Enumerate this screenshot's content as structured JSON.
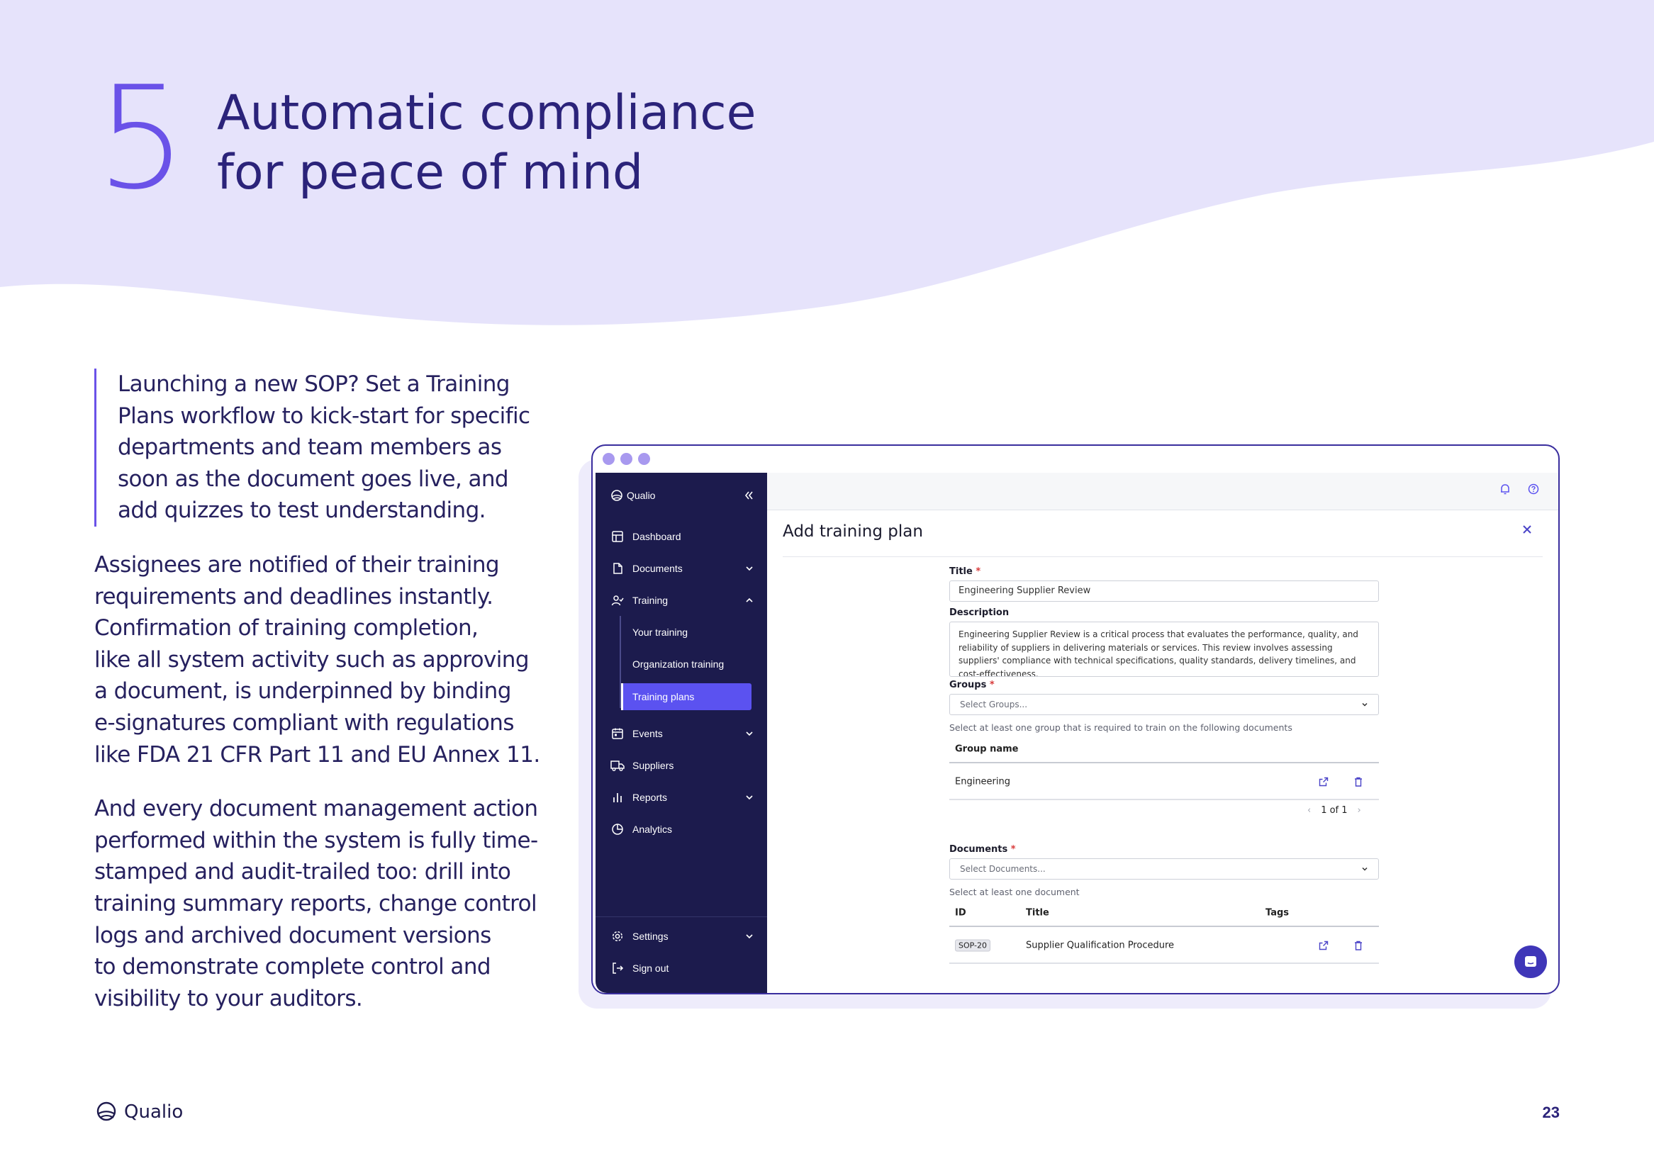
{
  "hero": {
    "number": "5",
    "title_line1": "Automatic compliance",
    "title_line2": "for peace of mind"
  },
  "intro_quote": [
    "Launching a new SOP? Set a Training",
    "Plans workflow to kick-start for specific",
    "departments and team members as",
    "soon as the document goes live, and",
    "add quizzes to test understanding."
  ],
  "paragraph2": [
    "Assignees are notified of their training",
    "requirements and deadlines instantly.",
    "Confirmation of training completion,",
    "like all system activity such as approving",
    "a document, is underpinned by binding",
    "e-signatures compliant with regulations",
    "like FDA 21 CFR Part 11 and EU Annex 11."
  ],
  "paragraph3": [
    "And every document management action",
    "performed within the system is fully time-",
    "stamped and audit-trailed too: drill into",
    "training summary reports, change control",
    "logs and archived document versions",
    "to demonstrate complete control and",
    "visibility to your auditors."
  ],
  "footer": {
    "brand": "Qualio",
    "page_number": "23"
  },
  "colors": {
    "hero_bg": "#e6e3fb",
    "accent": "#6a52e8",
    "sidebar": "#1c1b4d",
    "active": "#5b52f0"
  },
  "app": {
    "brand": "Qualio",
    "sidebar": {
      "items": [
        {
          "label": "Dashboard",
          "icon": "dashboard-icon"
        },
        {
          "label": "Documents",
          "icon": "document-icon"
        },
        {
          "label": "Training",
          "icon": "user-check-icon"
        },
        {
          "label": "Events",
          "icon": "calendar-icon"
        },
        {
          "label": "Suppliers",
          "icon": "truck-icon"
        },
        {
          "label": "Reports",
          "icon": "bar-chart-icon"
        },
        {
          "label": "Analytics",
          "icon": "pie-chart-icon"
        }
      ],
      "training_sub": [
        "Your training",
        "Organization training",
        "Training plans"
      ],
      "settings": "Settings",
      "signout": "Sign out"
    },
    "panel": {
      "title": "Add training plan",
      "title_label": "Title",
      "title_value": "Engineering Supplier Review",
      "description_label": "Description",
      "description_value": "Engineering Supplier Review is a critical process that evaluates the performance, quality, and reliability of suppliers in delivering materials or services. This review involves assessing suppliers' compliance with technical specifications, quality standards, delivery timelines, and cost-effectiveness.",
      "groups_label": "Groups",
      "groups_placeholder": "Select Groups...",
      "groups_help": "Select at least one group that is required to train on the following documents",
      "group_col": "Group name",
      "group_row": "Engineering",
      "pager": "1 of 1",
      "documents_label": "Documents",
      "documents_placeholder": "Select Documents...",
      "documents_help": "Select at least one document",
      "doc_cols": {
        "id": "ID",
        "title": "Title",
        "tags": "Tags"
      },
      "doc_row": {
        "id": "SOP-20",
        "title": "Supplier Qualification Procedure"
      }
    }
  }
}
